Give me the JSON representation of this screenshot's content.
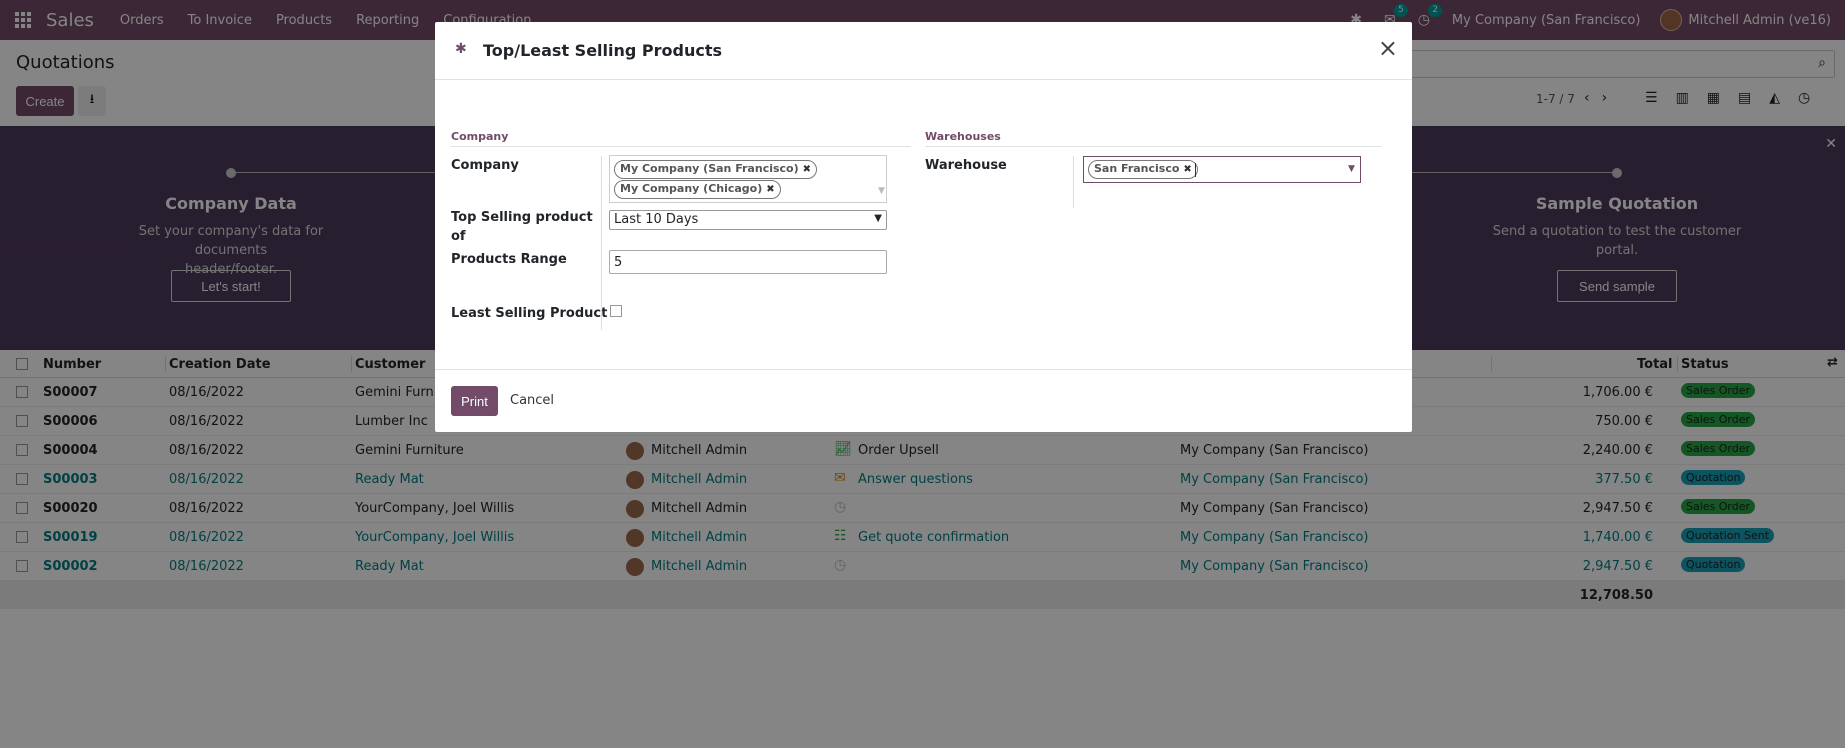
{
  "navbar": {
    "app_name": "Sales",
    "menu": [
      "Orders",
      "To Invoice",
      "Products",
      "Reporting",
      "Configuration"
    ],
    "messages_count": "5",
    "activities_count": "2",
    "company": "My Company (San Francisco)",
    "user": "Mitchell Admin (ve16)"
  },
  "control_panel": {
    "title": "Quotations",
    "create_label": "Create",
    "pager": "1-7 / 7"
  },
  "banner": {
    "steps": [
      {
        "title": "Company Data",
        "desc1": "Set your company's data for documents",
        "desc2": "header/footer.",
        "button": "Let's start!"
      },
      {
        "title": "Sample Quotation",
        "desc1": "Send a quotation to test the customer",
        "desc2": "portal.",
        "button": "Send sample"
      }
    ]
  },
  "table": {
    "headers": {
      "number": "Number",
      "creation_date": "Creation Date",
      "customer": "Customer",
      "total": "Total",
      "status": "Status"
    },
    "rows": [
      {
        "number": "S00007",
        "date": "08/16/2022",
        "customer": "Gemini Furniture",
        "salesperson": "",
        "activity": "",
        "company": "",
        "total": "1,706.00 €",
        "status": "Sales Order"
      },
      {
        "number": "S00006",
        "date": "08/16/2022",
        "customer": "Lumber Inc",
        "salesperson": "",
        "activity": "",
        "company": "",
        "total": "750.00 €",
        "status": "Sales Order"
      },
      {
        "number": "S00004",
        "date": "08/16/2022",
        "customer": "Gemini Furniture",
        "salesperson": "Mitchell Admin",
        "activity": "Order Upsell",
        "company": "My Company (San Francisco)",
        "total": "2,240.00 €",
        "status": "Sales Order"
      },
      {
        "number": "S00003",
        "date": "08/16/2022",
        "customer": "Ready Mat",
        "salesperson": "Mitchell Admin",
        "activity": "Answer questions",
        "company": "My Company (San Francisco)",
        "total": "377.50 €",
        "status": "Quotation"
      },
      {
        "number": "S00020",
        "date": "08/16/2022",
        "customer": "YourCompany, Joel Willis",
        "salesperson": "Mitchell Admin",
        "activity": "",
        "company": "My Company (San Francisco)",
        "total": "2,947.50 €",
        "status": "Sales Order"
      },
      {
        "number": "S00019",
        "date": "08/16/2022",
        "customer": "YourCompany, Joel Willis",
        "salesperson": "Mitchell Admin",
        "activity": "Get quote confirmation",
        "company": "My Company (San Francisco)",
        "total": "1,740.00 €",
        "status": "Quotation Sent"
      },
      {
        "number": "S00002",
        "date": "08/16/2022",
        "customer": "Ready Mat",
        "salesperson": "Mitchell Admin",
        "activity": "",
        "company": "My Company (San Francisco)",
        "total": "2,947.50 €",
        "status": "Quotation"
      }
    ],
    "grand_total": "12,708.50"
  },
  "modal": {
    "title": "Top/Least Selling Products",
    "company_section": "Company",
    "warehouse_section": "Warehouses",
    "company_label": "Company",
    "company_tags": [
      "My Company (San Francisco)",
      "My Company (Chicago)"
    ],
    "top_selling_label_1": "Top Selling product",
    "top_selling_label_2": "of",
    "top_selling_value": "Last 10 Days",
    "range_label": "Products Range",
    "range_value": "5",
    "least_selling_label": "Least Selling Product",
    "warehouse_label": "Warehouse",
    "warehouse_tags": [
      "San Francisco"
    ],
    "print_label": "Print",
    "cancel_label": "Cancel"
  },
  "colors": {
    "brand": "#714b67",
    "link": "#017e84",
    "status_green": "#28a745",
    "status_teal": "#17a2b8"
  }
}
